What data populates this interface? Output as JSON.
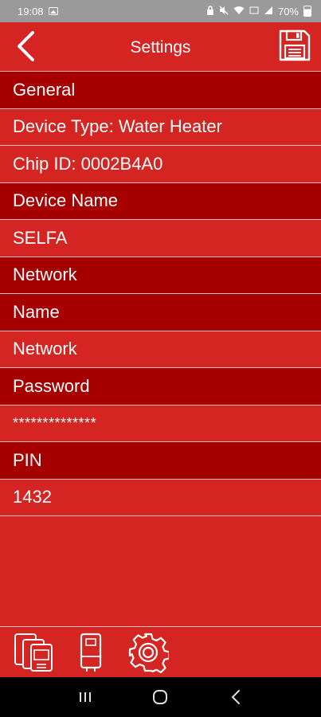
{
  "status_bar": {
    "time": "19:08",
    "battery": "70%",
    "icons": [
      "image-icon",
      "lock-icon",
      "mute-icon",
      "wifi-icon",
      "volte-icon",
      "signal-icon",
      "battery-icon"
    ]
  },
  "app_bar": {
    "title": "Settings",
    "back_icon": "chevron-left-icon",
    "save_icon": "floppy-disk-icon"
  },
  "settings": {
    "general_header": "General",
    "device_type": "Device Type: Water Heater",
    "chip_id": "Chip ID: 0002B4A0",
    "device_name_header": "Device Name",
    "device_name_value": "SELFA",
    "network_header": "Network",
    "name_header": "Name",
    "network_name_value": "Network",
    "password_header": "Password",
    "password_value": "**************",
    "pin_header": "PIN",
    "pin_value": "1432"
  },
  "tab_bar": {
    "tabs": [
      "devices-icon",
      "water-heater-icon",
      "gear-icon"
    ]
  },
  "colors": {
    "primary": "#d52522",
    "header_row": "#a70000",
    "divider": "#f2c0be",
    "status_bar": "#9a9a9a",
    "nav_bar": "#000000"
  }
}
